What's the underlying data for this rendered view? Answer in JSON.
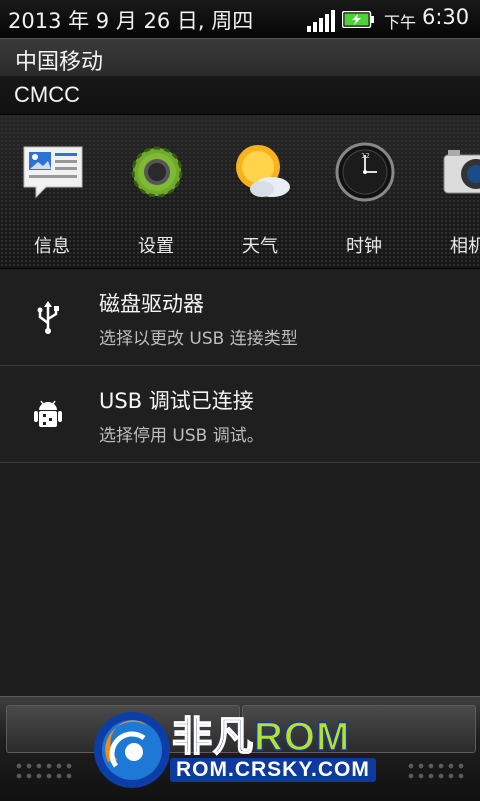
{
  "status": {
    "date": "2013 年 9 月 26 日, 周四",
    "ampm": "下午",
    "time": "6:30"
  },
  "operator": "中国移动",
  "network": "CMCC",
  "quick_apps": [
    {
      "label": "信息",
      "icon": "messages-icon"
    },
    {
      "label": "设置",
      "icon": "settings-gear-icon"
    },
    {
      "label": "天气",
      "icon": "weather-icon"
    },
    {
      "label": "时钟",
      "icon": "clock-icon"
    },
    {
      "label": "相机",
      "icon": "camera-icon"
    }
  ],
  "notifications": [
    {
      "title": "磁盘驱动器",
      "subtitle": "选择以更改 USB 连接类型",
      "icon": "usb-icon"
    },
    {
      "title": "USB 调试已连接",
      "subtitle": "选择停用 USB 调试。",
      "icon": "android-debug-icon"
    }
  ],
  "watermark": {
    "brand_cn": "非凡",
    "brand_rom": "ROM",
    "url": "ROM.CRSKY.COM"
  },
  "colors": {
    "battery_charging": "#4fd13a",
    "watermark_blue": "#0e3aa0",
    "watermark_green": "#b7e02c"
  }
}
